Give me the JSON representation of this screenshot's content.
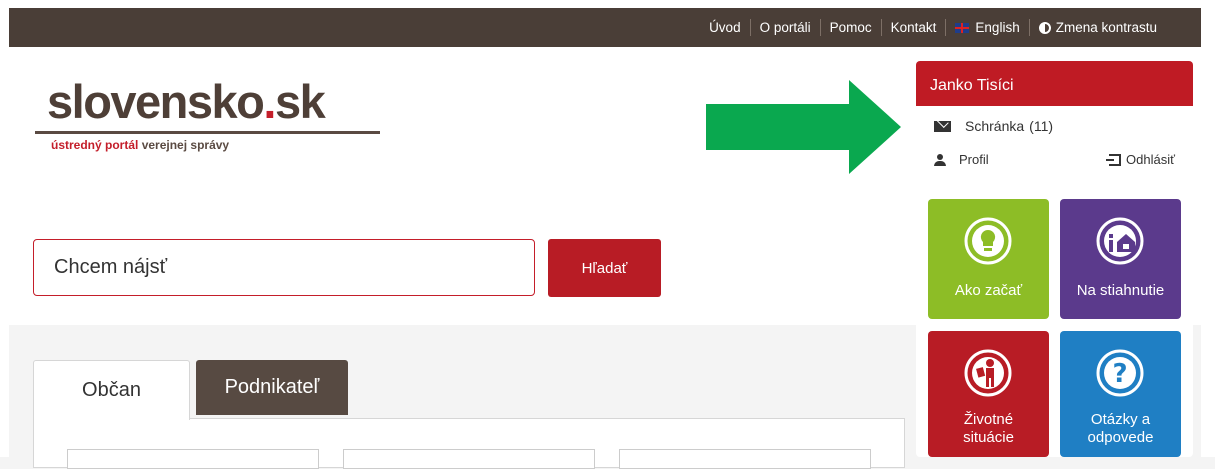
{
  "topbar": {
    "links": [
      "Úvod",
      "O portáli",
      "Pomoc",
      "Kontakt"
    ],
    "english": "English",
    "contrast": "Zmena kontrastu",
    "flag_icon": "uk-flag-icon",
    "contrast_icon": "half-circle-contrast-icon"
  },
  "logo": {
    "main": "slovensko",
    "dot": ".",
    "tld": "sk",
    "sub_red": "ústredný portál",
    "sub_rest": " verejnej správy"
  },
  "search": {
    "placeholder": "Chcem nájsť",
    "button": "Hľadať"
  },
  "tabs": [
    {
      "label": "Občan",
      "active": true
    },
    {
      "label": "Podnikateľ",
      "active": false
    }
  ],
  "user": {
    "name": "Janko Tisíci",
    "inbox_label": "Schránka",
    "inbox_count": "(11)",
    "profile": "Profil",
    "logout": "Odhlásiť"
  },
  "tiles": [
    {
      "line1": "Ako začať",
      "line2": "",
      "color": "#8dbd26",
      "icon": "lightbulb-icon"
    },
    {
      "line1": "Na stiahnutie",
      "line2": "",
      "color": "#5b3a8c",
      "icon": "info-house-icon"
    },
    {
      "line1": "Životné",
      "line2": "situácie",
      "color": "#b81c25",
      "icon": "person-icon"
    },
    {
      "line1": "Otázky a",
      "line2": "odpovede",
      "color": "#1f7fc4",
      "icon": "question-icon"
    }
  ],
  "colors": {
    "topbar": "#4a3e37",
    "brand_red": "#bf1b24",
    "annotation_arrow": "#0aa84f"
  }
}
